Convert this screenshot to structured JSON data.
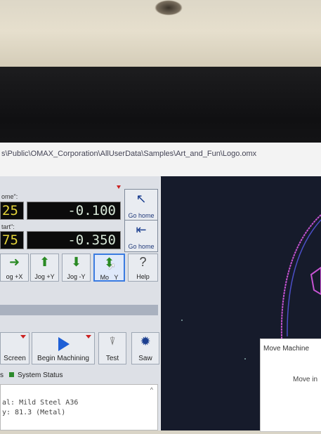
{
  "window": {
    "path": "s\\Public\\OMAX_Corporation\\AllUserData\\Samples\\Art_and_Fun\\Logo.omx"
  },
  "position": {
    "home_label": "ome\":",
    "start_label": "tart\":",
    "home_small": "25",
    "start_small": "75",
    "y_home": "-0.100",
    "y_start": "-0.350",
    "go_home_1": "Go home",
    "go_home_2": "Go home"
  },
  "jog": [
    {
      "label": "og +X"
    },
    {
      "label": "Jog +Y"
    },
    {
      "label": "Jog -Y"
    },
    {
      "label": "Mo   Y"
    },
    {
      "label": "Help"
    }
  ],
  "toolbar": {
    "screen": "Screen",
    "begin_machining": "Begin Machining",
    "test": "Test",
    "saw": "Saw"
  },
  "status": {
    "prefix": "s",
    "system_status": "System Status"
  },
  "console": {
    "line1": "al: Mild Steel A36",
    "line2": "y: 81.3 (Metal)"
  },
  "popup": {
    "title": "Move Machine",
    "body": "Move in"
  },
  "colors": {
    "accent_blue": "#1b3e8f",
    "arrow_green": "#2a8a24",
    "toolpath_magenta": "#d04fd8"
  }
}
